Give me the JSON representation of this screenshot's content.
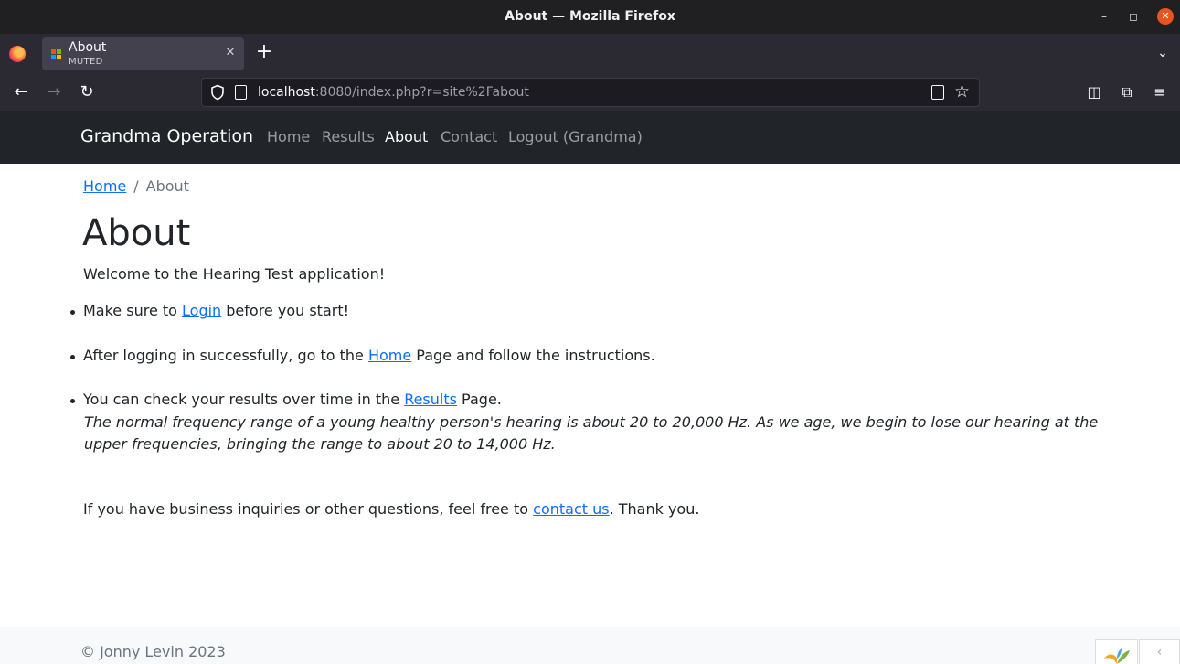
{
  "window": {
    "title": "About — Mozilla Firefox",
    "minimize_icon": "–",
    "maximize_icon": "◻",
    "close_icon": "✕"
  },
  "tab": {
    "title": "About",
    "subtitle": "MUTED",
    "close_icon": "✕",
    "new_tab_icon": "+",
    "tab_list_icon": "⌄"
  },
  "toolbar": {
    "back_icon": "←",
    "forward_icon": "→",
    "reload_icon": "↻",
    "url_host": "localhost",
    "url_rest": ":8080/index.php?r=site%2Fabout",
    "bookmark_icon": "☆",
    "pocket_icon": "◫",
    "extensions_icon": "⧉",
    "menu_icon": "≡"
  },
  "site": {
    "brand": "Grandma Operation",
    "nav": [
      "Home",
      "Results",
      "About",
      "Contact",
      "Logout (Grandma)"
    ],
    "active_nav": "About"
  },
  "breadcrumb": {
    "home": "Home",
    "separator": "/",
    "current": "About"
  },
  "page": {
    "title": "About",
    "welcome": "Welcome to the Hearing Test application!",
    "item1_before": "Make sure to ",
    "item1_link": "Login",
    "item1_after": " before you start!",
    "item2_before": "After logging in successfully, go to the ",
    "item2_link": "Home",
    "item2_after": " Page and follow the instructions.",
    "item3_before": "You can check your results over time in the ",
    "item3_link": "Results",
    "item3_after": " Page.",
    "note": "The normal frequency range of a young healthy person's hearing is about 20 to 20,000 Hz. As we age, we begin to lose our hearing at the upper frequencies, bringing the range to about 20 to 14,000 Hz.",
    "contact_before": "If you have business inquiries or other questions, feel free to ",
    "contact_link": "contact us",
    "contact_after": ". Thank you."
  },
  "footer": {
    "copyright": "© Jonny Levin 2023",
    "debug_arrow": "‹"
  },
  "colors": {
    "link": "#0d6efd",
    "navbar_bg": "#212529",
    "browser_bg": "#2b2a33",
    "close_accent": "#e95420"
  }
}
